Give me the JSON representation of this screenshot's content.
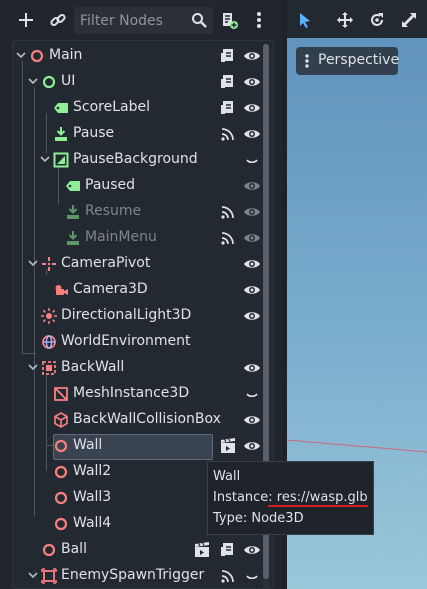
{
  "toolbar": {
    "add_icon": "plus-icon",
    "link_icon": "chain-link-icon",
    "filter_placeholder": "Filter Nodes",
    "search_icon": "search-icon",
    "script_icon": "script-add-icon",
    "menu_icon": "kebab-menu-icon"
  },
  "tree": [
    {
      "label": "Main",
      "icon": "node3d-icon",
      "depth": 0,
      "expanded": true,
      "buttons": [
        "script-icon",
        "visibility-eye-icon"
      ],
      "dim": false
    },
    {
      "label": "UI",
      "icon": "control-icon",
      "depth": 1,
      "expanded": true,
      "buttons": [
        "script-icon",
        "visibility-eye-icon"
      ],
      "dim": false
    },
    {
      "label": "ScoreLabel",
      "icon": "label-icon",
      "depth": 2,
      "expanded": null,
      "buttons": [
        "script-icon",
        "visibility-eye-icon"
      ],
      "dim": false
    },
    {
      "label": "Pause",
      "icon": "texture-button-icon",
      "depth": 2,
      "expanded": null,
      "buttons": [
        "signal-icon",
        "visibility-eye-icon"
      ],
      "dim": false
    },
    {
      "label": "PauseBackground",
      "icon": "color-rect-icon",
      "depth": 2,
      "expanded": true,
      "buttons": [
        "collapse-icon"
      ],
      "dim": false
    },
    {
      "label": "Paused",
      "icon": "label-icon",
      "depth": 3,
      "expanded": null,
      "buttons": [
        "visibility-eye-icon"
      ],
      "dim": false
    },
    {
      "label": "Resume",
      "icon": "texture-button-icon",
      "depth": 3,
      "expanded": null,
      "buttons": [
        "signal-icon",
        "visibility-eye-icon"
      ],
      "dim": true
    },
    {
      "label": "MainMenu",
      "icon": "texture-button-icon",
      "depth": 3,
      "expanded": null,
      "buttons": [
        "signal-icon",
        "visibility-eye-icon"
      ],
      "dim": true
    },
    {
      "label": "CameraPivot",
      "icon": "marker3d-icon",
      "depth": 1,
      "expanded": true,
      "buttons": [
        "visibility-eye-icon"
      ],
      "dim": false
    },
    {
      "label": "Camera3D",
      "icon": "camera3d-icon",
      "depth": 2,
      "expanded": null,
      "buttons": [
        "visibility-eye-icon"
      ],
      "dim": false
    },
    {
      "label": "DirectionalLight3D",
      "icon": "light-icon",
      "depth": 1,
      "expanded": null,
      "buttons": [
        "visibility-eye-icon"
      ],
      "dim": false
    },
    {
      "label": "WorldEnvironment",
      "icon": "world-environment-icon",
      "depth": 1,
      "expanded": null,
      "buttons": [],
      "dim": false
    },
    {
      "label": "BackWall",
      "icon": "static-body-icon",
      "depth": 1,
      "expanded": true,
      "buttons": [
        "visibility-eye-icon"
      ],
      "dim": false
    },
    {
      "label": "MeshInstance3D",
      "icon": "mesh-instance-icon",
      "depth": 2,
      "expanded": null,
      "buttons": [
        "collapse-icon"
      ],
      "dim": false
    },
    {
      "label": "BackWallCollisionBox",
      "icon": "collision-shape-icon",
      "depth": 2,
      "expanded": null,
      "buttons": [
        "visibility-eye-icon"
      ],
      "dim": false
    },
    {
      "label": "Wall",
      "icon": "node3d-icon",
      "depth": 2,
      "expanded": null,
      "buttons": [
        "open-scene-icon",
        "visibility-eye-icon"
      ],
      "dim": false,
      "selected": true
    },
    {
      "label": "Wall2",
      "icon": "node3d-icon",
      "depth": 2,
      "expanded": null,
      "buttons": [],
      "dim": false
    },
    {
      "label": "Wall3",
      "icon": "node3d-icon",
      "depth": 2,
      "expanded": null,
      "buttons": [],
      "dim": false
    },
    {
      "label": "Wall4",
      "icon": "node3d-icon",
      "depth": 2,
      "expanded": null,
      "buttons": [],
      "dim": false
    },
    {
      "label": "Ball",
      "icon": "node3d-icon",
      "depth": 1,
      "expanded": null,
      "buttons": [
        "open-scene-icon",
        "script-icon",
        "visibility-eye-icon"
      ],
      "dim": false
    },
    {
      "label": "EnemySpawnTrigger",
      "icon": "area3d-icon",
      "depth": 1,
      "expanded": true,
      "buttons": [
        "signal-icon",
        "collapse-icon"
      ],
      "dim": false
    }
  ],
  "viewport": {
    "tools": [
      "select-arrow-icon",
      "move-icon",
      "rotate-icon",
      "scale-icon"
    ],
    "perspective_label": "Perspective"
  },
  "tooltip": {
    "name": "Wall",
    "instance_line": "Instance: res://wasp.glb",
    "type_line": "Type: Node3D"
  },
  "colors": {
    "panel_bg": "#21262e",
    "selected_bg": "#3a4350",
    "node3d": "#fc7f7f",
    "control": "#8eef97",
    "viewport_sky": "#79adcd",
    "highlight_underline": "#d42020"
  }
}
